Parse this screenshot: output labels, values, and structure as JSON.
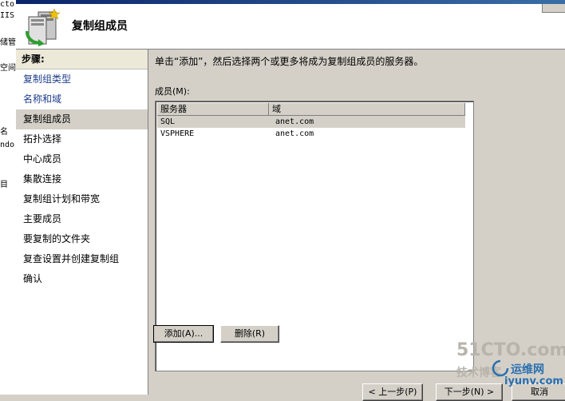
{
  "background": {
    "fragments": [
      "cto",
      "IIS",
      "储管",
      "空间",
      "名",
      "ndo",
      "目"
    ]
  },
  "header": {
    "title": "复制组成员",
    "icon": "replication-wizard-icon"
  },
  "steps": {
    "heading": "步骤:",
    "items": [
      {
        "label": "复制组类型",
        "state": "done"
      },
      {
        "label": "名称和域",
        "state": "done"
      },
      {
        "label": "复制组成员",
        "state": "current"
      },
      {
        "label": "拓扑选择",
        "state": "pending"
      },
      {
        "label": "中心成员",
        "state": "pending"
      },
      {
        "label": "集散连接",
        "state": "pending"
      },
      {
        "label": "复制组计划和带宽",
        "state": "pending"
      },
      {
        "label": "主要成员",
        "state": "pending"
      },
      {
        "label": "要复制的文件夹",
        "state": "pending"
      },
      {
        "label": "复查设置并创建复制组",
        "state": "pending"
      },
      {
        "label": "确认",
        "state": "pending"
      }
    ]
  },
  "main": {
    "instruction": "单击“添加”，然后选择两个或更多将成为复制组成员的服务器。",
    "members_label": "成员(M):",
    "columns": [
      "服务器",
      "域"
    ],
    "rows": [
      {
        "server": "SQL",
        "domain": "anet.com",
        "selected": true
      },
      {
        "server": "VSPHERE",
        "domain": "anet.com",
        "selected": false
      }
    ],
    "add_label": "添加(A)...",
    "remove_label": "删除(R)"
  },
  "footer": {
    "back_label": "< 上一步(P)",
    "next_label": "下一步(N) >",
    "cancel_label": "取消"
  },
  "watermark": {
    "line1": "51CTO.com",
    "line2": "技术博客",
    "line3": "运维网",
    "line4": "iyunv.com"
  },
  "colors": {
    "dialog_bg": "#d4d0c8",
    "link": "#1e3e8c",
    "title_bar": "#0a246a"
  }
}
